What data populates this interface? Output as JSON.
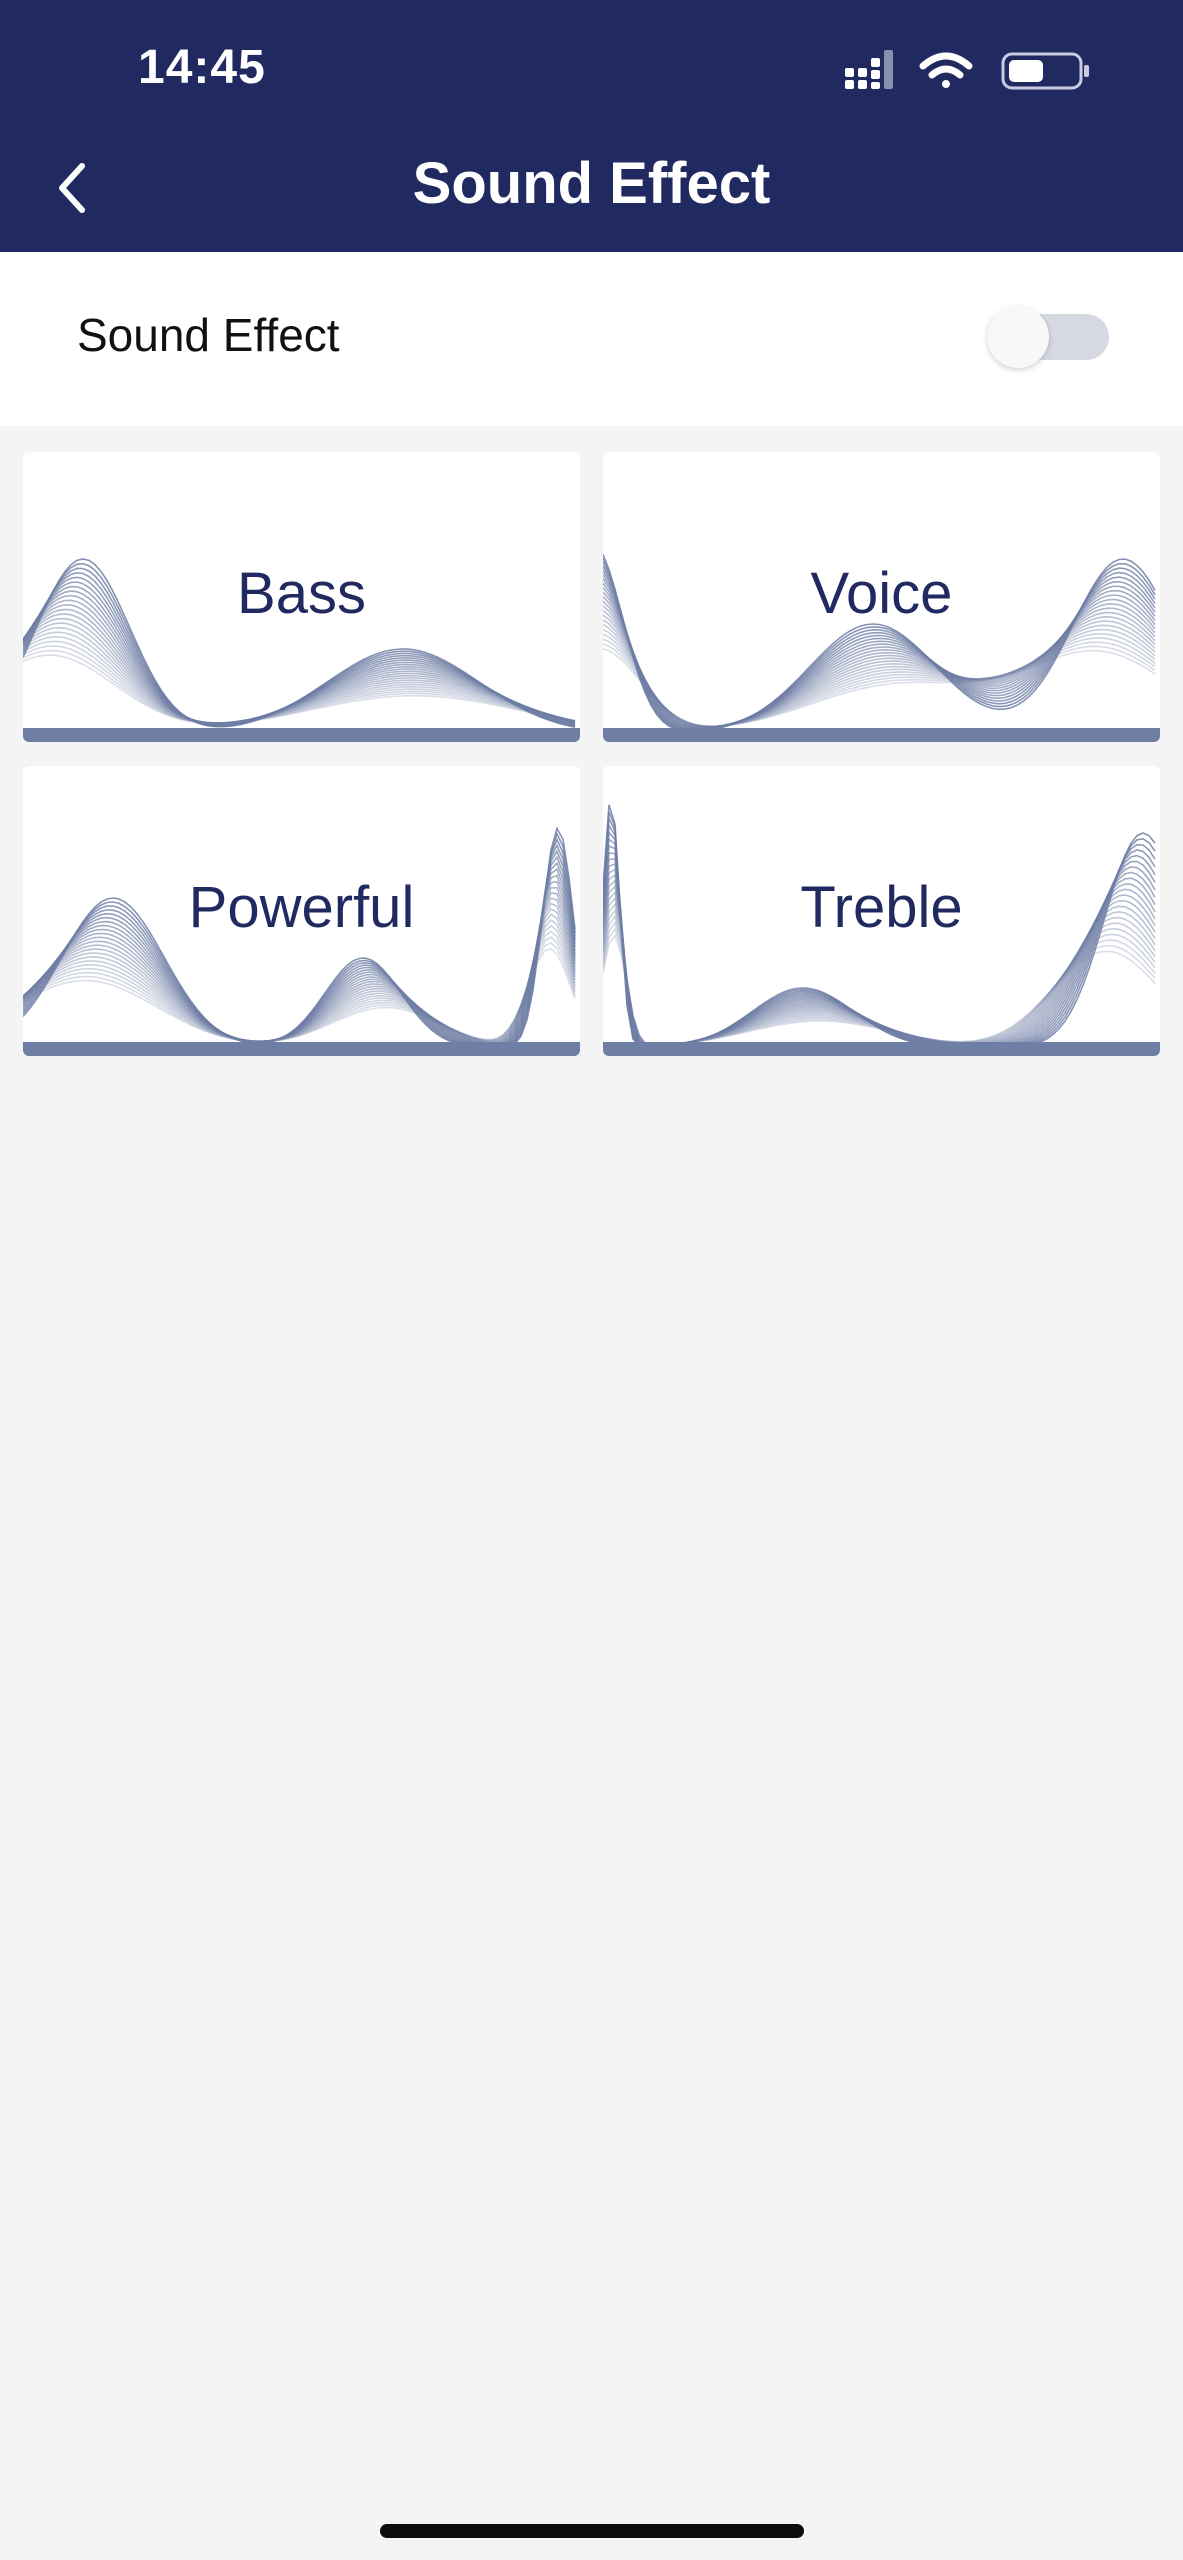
{
  "status_bar": {
    "time": "14:45"
  },
  "header": {
    "title": "Sound Effect",
    "back_icon": "chevron-left-icon"
  },
  "sound_effect_switch": {
    "label": "Sound Effect",
    "enabled": false
  },
  "effects": [
    {
      "label": "Bass"
    },
    {
      "label": "Voice"
    },
    {
      "label": "Powerful"
    },
    {
      "label": "Treble"
    }
  ],
  "colors": {
    "header_bg": "#212a60",
    "wave": "#6f7ea5",
    "page_bg": "#f4f4f4"
  }
}
